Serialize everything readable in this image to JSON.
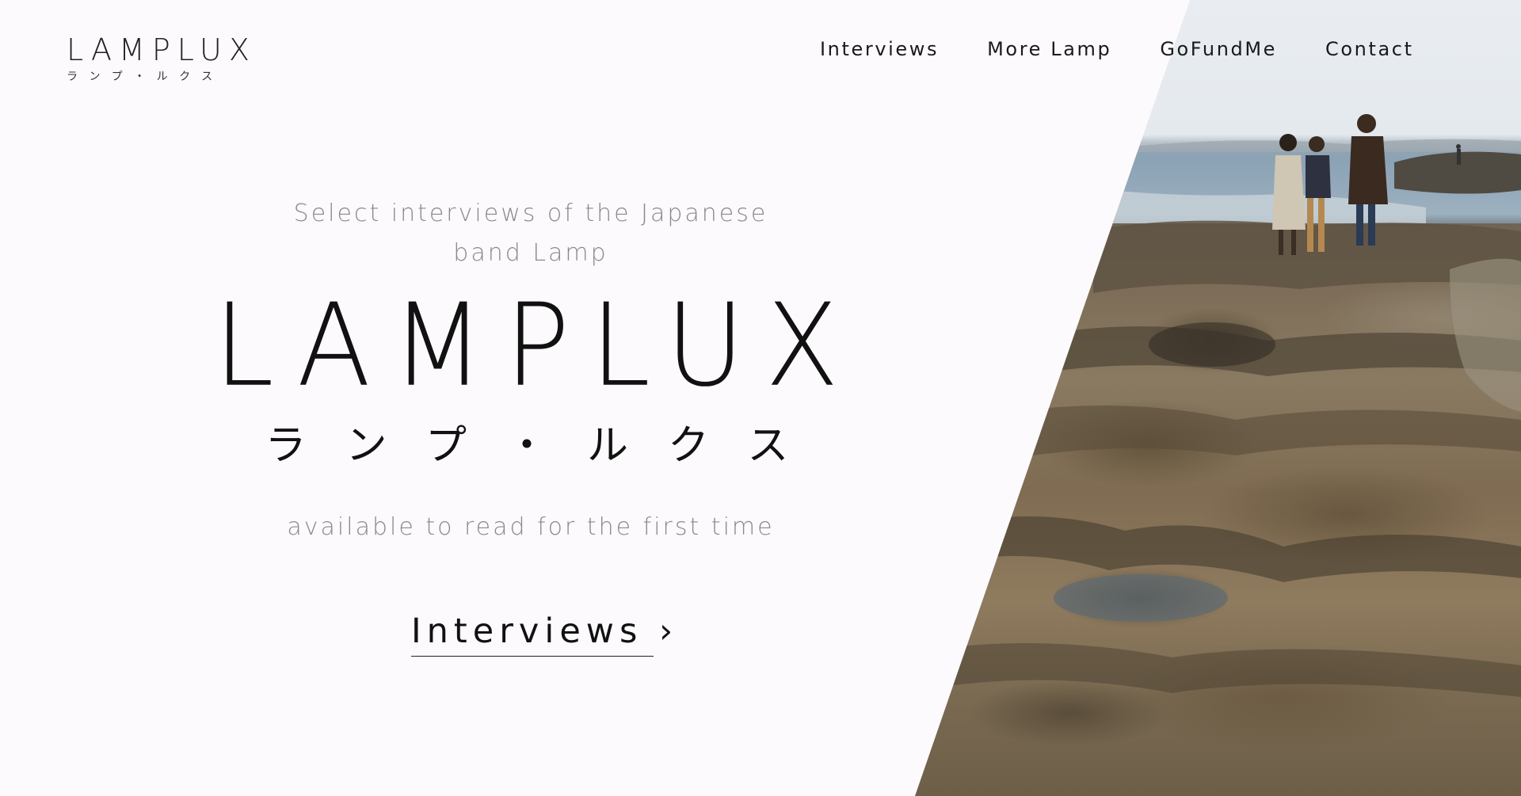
{
  "header": {
    "logo_text": "LAMPLUX",
    "logo_subtext": "ランプ・ルクス",
    "nav": [
      {
        "label": "Interviews"
      },
      {
        "label": "More Lamp"
      },
      {
        "label": "GoFundMe"
      },
      {
        "label": "Contact"
      }
    ]
  },
  "hero": {
    "tagline": "Select interviews of the Japanese band Lamp",
    "title": "LAMPLUX",
    "title_japanese": "ランプ・ルクス",
    "description": "available to read for the first time",
    "cta_label": "Interviews ›"
  },
  "colors": {
    "background": "#fcfafc",
    "text_dark": "#111111",
    "text_muted": "#8a8a8a"
  }
}
